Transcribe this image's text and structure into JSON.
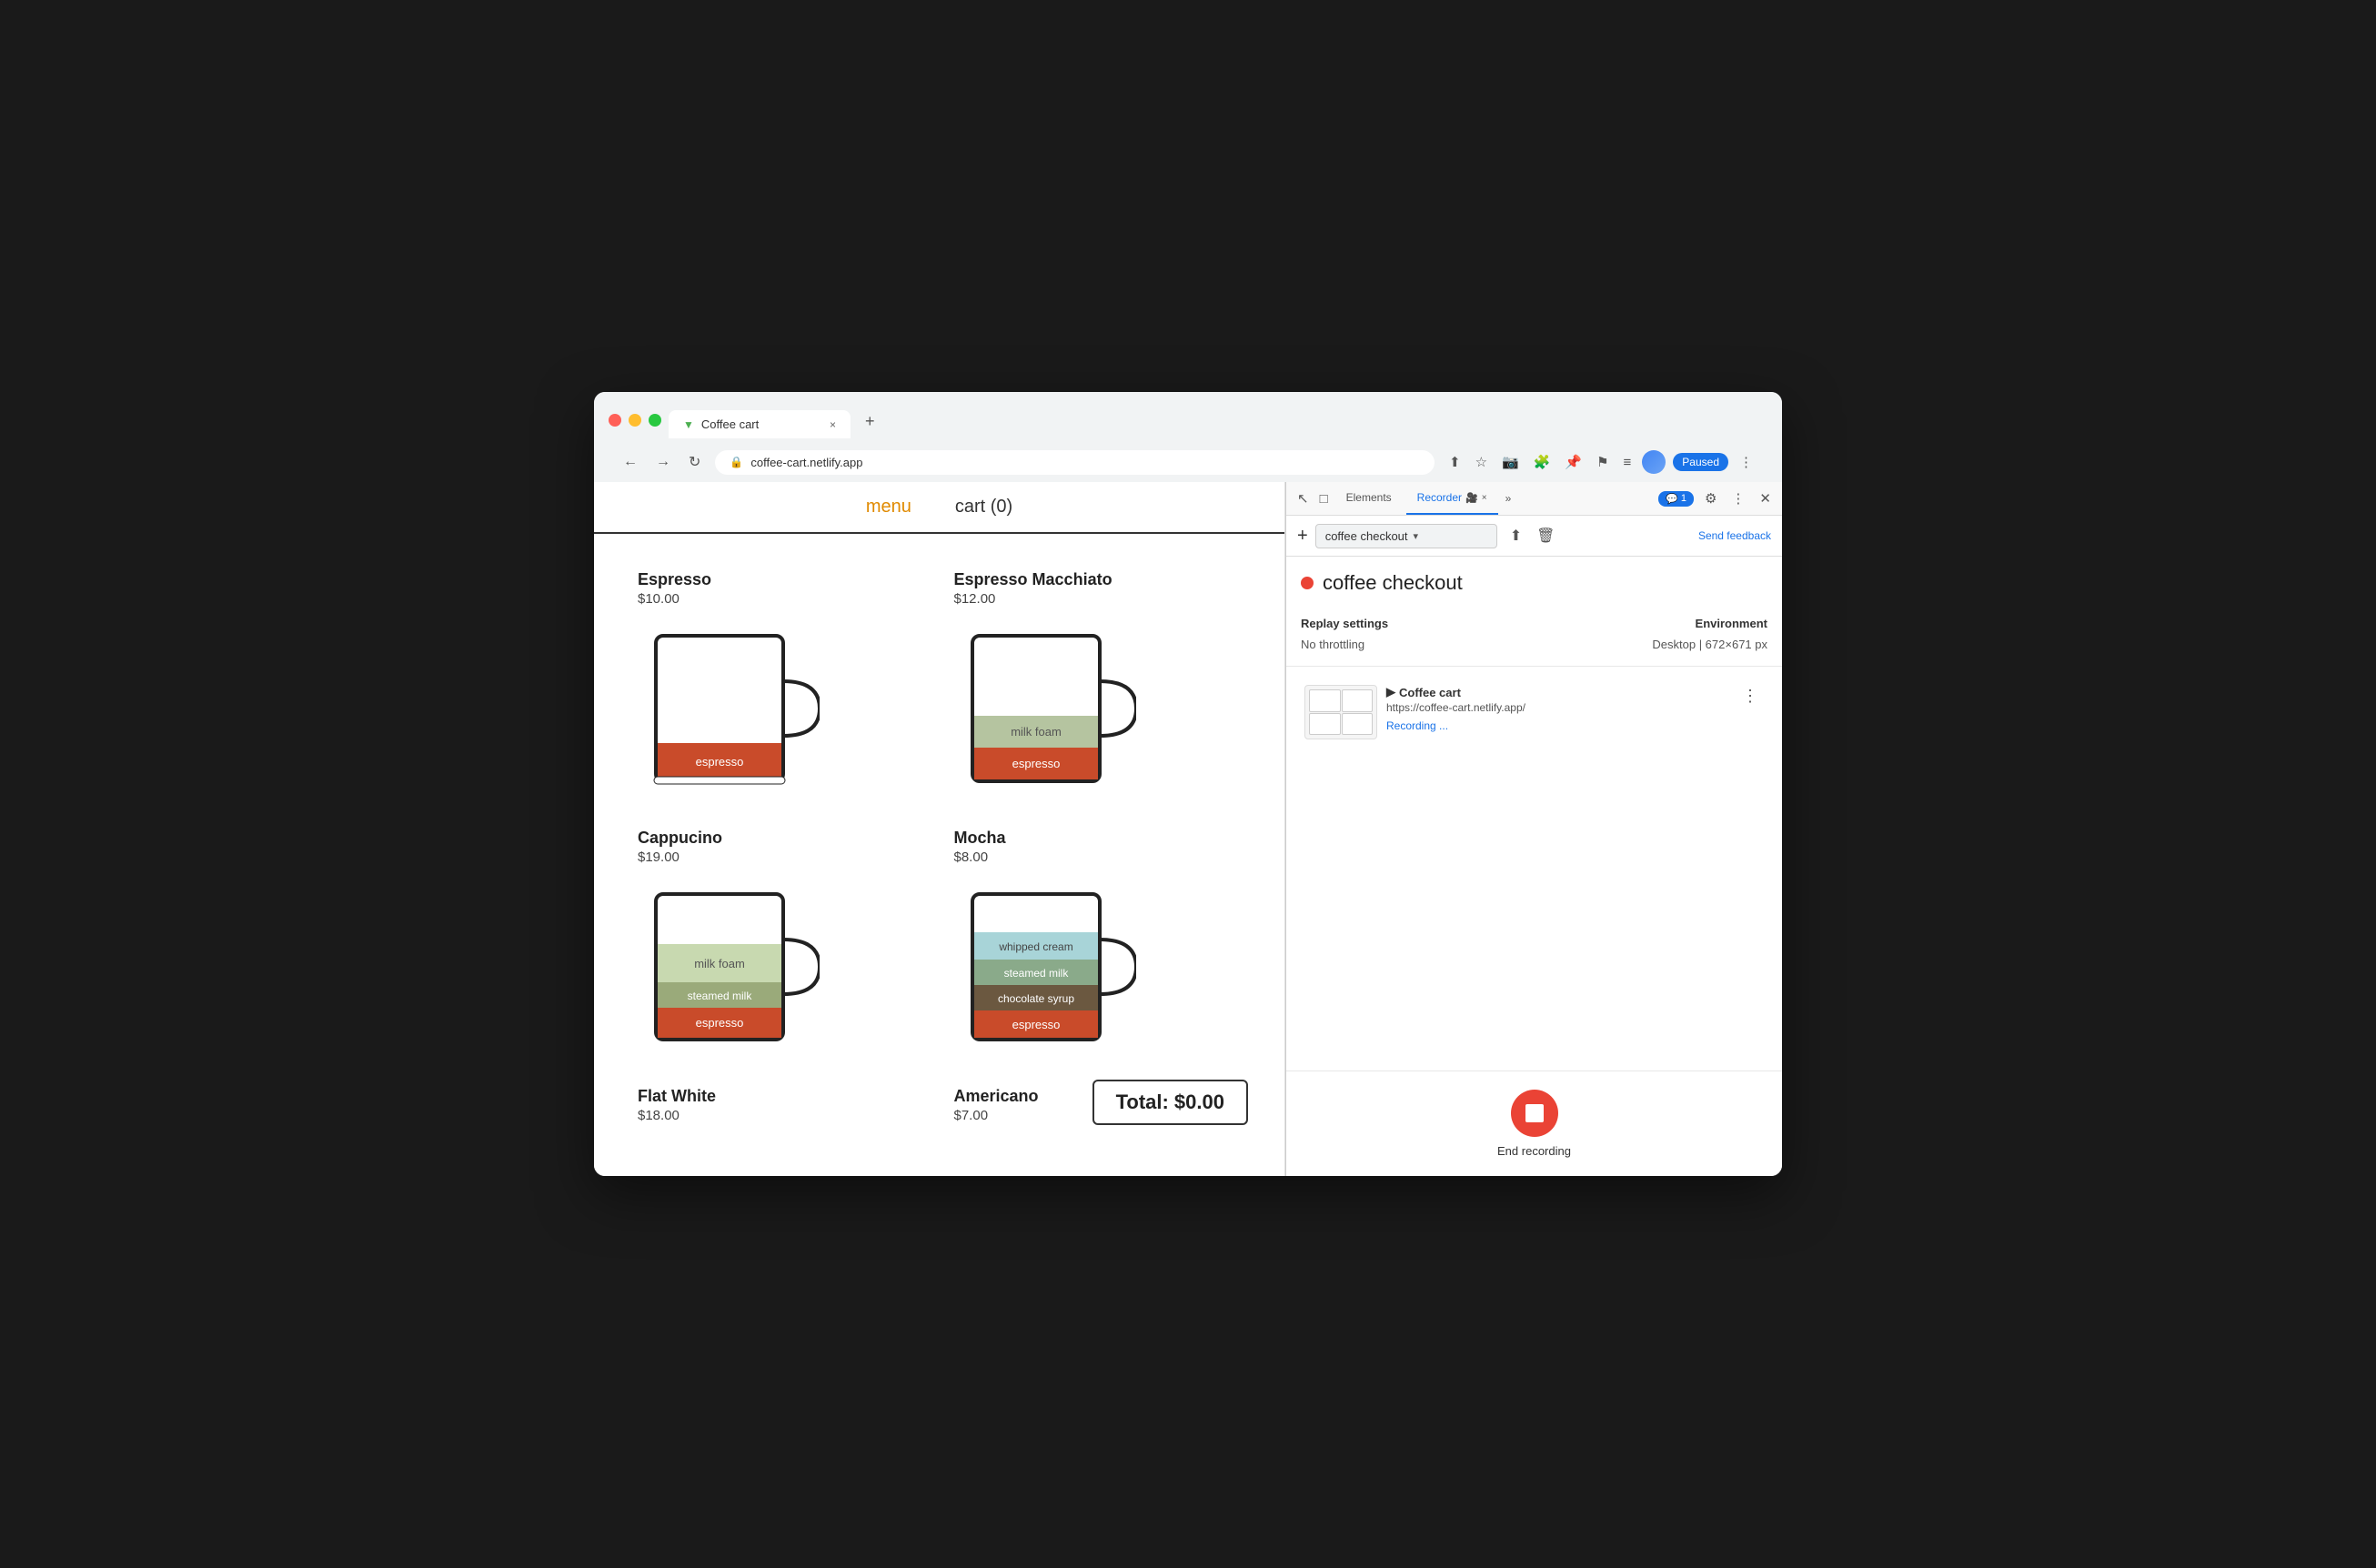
{
  "browser": {
    "tab_favicon": "▼",
    "tab_title": "Coffee cart",
    "tab_close": "×",
    "tab_new": "+",
    "nav_back": "←",
    "nav_forward": "→",
    "nav_reload": "↻",
    "address_url": "coffee-cart.netlify.app",
    "action_share": "⬆",
    "action_star": "☆",
    "action_extensions": "⚙",
    "action_more": "⋮",
    "paused_label": "Paused"
  },
  "coffee_page": {
    "nav_menu": "menu",
    "nav_cart": "cart (0)",
    "items": [
      {
        "name": "Espresso",
        "price": "$10.00",
        "layers": [
          {
            "label": "espresso",
            "color": "#c94b2a",
            "height": 40
          }
        ],
        "type": "espresso"
      },
      {
        "name": "Espresso Macchiato",
        "price": "$12.00",
        "layers": [
          {
            "label": "milk foam",
            "color": "#b5c4a0",
            "height": 30
          },
          {
            "label": "espresso",
            "color": "#c94b2a",
            "height": 40
          }
        ],
        "type": "macchiato"
      },
      {
        "name": "Cappucino",
        "price": "$19.00",
        "layers": [
          {
            "label": "milk foam",
            "color": "#c8d9b0",
            "height": 50
          },
          {
            "label": "steamed milk",
            "color": "#9aaa7a",
            "height": 35
          },
          {
            "label": "espresso",
            "color": "#c94b2a",
            "height": 35
          }
        ],
        "type": "cappucino"
      },
      {
        "name": "Mocha",
        "price": "$8.00",
        "layers": [
          {
            "label": "whipped cream",
            "color": "#a8d4d8",
            "height": 30
          },
          {
            "label": "steamed milk",
            "color": "#8aaa8a",
            "height": 30
          },
          {
            "label": "chocolate syrup",
            "color": "#6b5840",
            "height": 30
          },
          {
            "label": "espresso",
            "color": "#c94b2a",
            "height": 30
          }
        ],
        "type": "mocha"
      },
      {
        "name": "Flat White",
        "price": "$18.00",
        "layers": [],
        "type": "flat_white"
      },
      {
        "name": "Americano",
        "price": "$7.00",
        "layers": [],
        "type": "americano"
      }
    ],
    "total_label": "Total: $0.00"
  },
  "devtools": {
    "tabs": [
      "Elements",
      "Recorder",
      "more"
    ],
    "recorder_tab": "Recorder",
    "close_recorder": "×",
    "chat_count": "1",
    "add_btn": "+",
    "recording_name": "coffee checkout",
    "send_feedback": "Send feedback",
    "recording_dot_color": "#ea4335",
    "recording_title": "coffee checkout",
    "replay_settings_label": "Replay settings",
    "no_throttling": "No throttling",
    "environment_label": "Environment",
    "environment_value": "Desktop | 672×671 px",
    "recording_site_name": "Coffee cart",
    "recording_url": "https://coffee-cart.netlify.app/",
    "recording_status": "Recording ...",
    "end_recording_label": "End recording"
  },
  "icons": {
    "back": "←",
    "forward": "→",
    "reload": "↻",
    "lock": "🔒",
    "more_vert": "⋮",
    "more_horiz": "···",
    "chevron_down": "▾",
    "chevron_right": "▶",
    "upload": "⬆",
    "trash": "🗑",
    "gear": "⚙",
    "cursor": "↖",
    "mobile": "📱",
    "inspect": "□",
    "pin": "📌",
    "bookmark": "☆",
    "camera": "📷",
    "extension": "🧩"
  }
}
